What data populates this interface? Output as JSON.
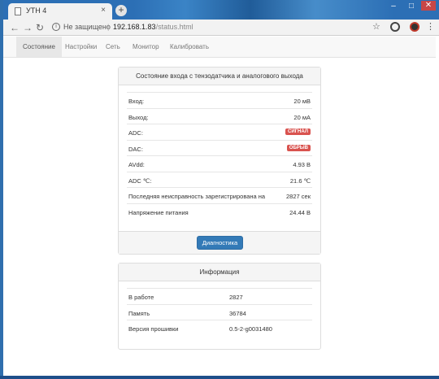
{
  "browser": {
    "tab_title": "УТН 4",
    "tab_close": "×",
    "new_tab": "+",
    "window_controls": [
      "–",
      "□",
      "✕"
    ],
    "address": {
      "insecure_label": "Не защищено",
      "separator": "|",
      "host": "192.168.1.83",
      "path": "/status.html"
    },
    "icons": [
      "back-icon",
      "forward-icon",
      "reload-icon",
      "info-icon",
      "star-icon",
      "extension-icon",
      "avatar-icon",
      "menu-icon"
    ]
  },
  "nav": {
    "items": [
      "Состояние",
      "Настройки",
      "Сеть",
      "Монитор",
      "Калибровать"
    ],
    "active": "Состояние"
  },
  "status_panel": {
    "title": "Состояние входа с тензодатчика и аналогового выхода",
    "rows": [
      {
        "label": "Вход:",
        "value": "20 мВ"
      },
      {
        "label": "Выход:",
        "value": "20 мА"
      },
      {
        "label": "ADC:",
        "badge": "СИГНАЛ"
      },
      {
        "label": "DAC:",
        "badge": "ОБРЫВ"
      },
      {
        "label": "AVdd:",
        "value": "4.93 В"
      },
      {
        "label": "ADC ℃:",
        "value": "21.6 ℃"
      },
      {
        "label": "Последняя неисправность зарегистрирована на",
        "value": "2827 сек"
      },
      {
        "label": "Напряжение питания",
        "value": "24.44 В"
      }
    ],
    "button": "Диагностика",
    "badge_color": "#d9534f",
    "button_color": "#337ab7"
  },
  "info_panel": {
    "title": "Информация",
    "rows": [
      {
        "label": "В работе",
        "value": "2827"
      },
      {
        "label": "Память",
        "value": "36784"
      },
      {
        "label": "Версия прошивки",
        "value": "0.5-2-g0031480"
      }
    ]
  }
}
